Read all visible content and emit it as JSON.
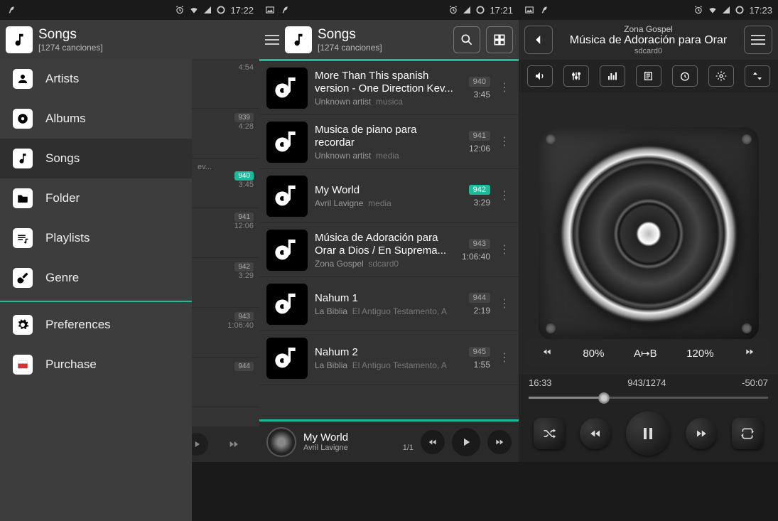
{
  "status": {
    "time1": "17:22",
    "time2": "17:21",
    "time3": "17:23"
  },
  "header": {
    "title": "Songs",
    "subtitle": "[1274 canciones]"
  },
  "drawer": {
    "items": [
      {
        "label": "Artists",
        "icon": "person-icon"
      },
      {
        "label": "Albums",
        "icon": "disc-icon"
      },
      {
        "label": "Songs",
        "icon": "music-note-icon"
      },
      {
        "label": "Folder",
        "icon": "folder-icon"
      },
      {
        "label": "Playlists",
        "icon": "playlist-icon"
      },
      {
        "label": "Genre",
        "icon": "guitar-icon"
      }
    ],
    "footer": [
      {
        "label": "Preferences",
        "icon": "gear-icon"
      },
      {
        "label": "Purchase",
        "icon": "cart-icon"
      }
    ]
  },
  "bg_peek": [
    {
      "badge": "",
      "dur": "4:54"
    },
    {
      "badge": "939",
      "dur": "4:28"
    },
    {
      "badge": "940",
      "dur": "3:45",
      "hl": true,
      "extra": "ev..."
    },
    {
      "badge": "941",
      "dur": "12:06"
    },
    {
      "badge": "942",
      "dur": "3:29"
    },
    {
      "badge": "943",
      "dur": "1:06:40"
    },
    {
      "badge": "944",
      "dur": ""
    }
  ],
  "songs": [
    {
      "title": "More Than This spanish version - One Direction Kev...",
      "artist": "Unknown artist",
      "source": "musica",
      "badge": "940",
      "dur": "3:45",
      "hl": false
    },
    {
      "title": "Musica de piano para recordar",
      "artist": "Unknown artist",
      "source": "media",
      "badge": "941",
      "dur": "12:06",
      "hl": false
    },
    {
      "title": "My World",
      "artist": "Avril Lavigne",
      "source": "media",
      "badge": "942",
      "dur": "3:29",
      "hl": true
    },
    {
      "title": "Música de Adoración para Orar a Dios / En Suprema...",
      "artist": "Zona Gospel",
      "source": "sdcard0",
      "badge": "943",
      "dur": "1:06:40",
      "hl": false
    },
    {
      "title": "Nahum 1",
      "artist": "La Biblia",
      "source": "El Antiguo Testamento, A",
      "badge": "944",
      "dur": "2:19",
      "hl": false
    },
    {
      "title": "Nahum 2",
      "artist": "La Biblia",
      "source": "El Antiguo Testamento, A",
      "badge": "945",
      "dur": "1:55",
      "hl": false
    }
  ],
  "now": {
    "title": "My World",
    "artist": "Avril Lavigne",
    "pos": "1/1"
  },
  "player": {
    "artist": "Zona Gospel",
    "title": "Música de Adoración para Orar",
    "source": "sdcard0",
    "ab_left": "80%",
    "ab_mid": "A↦B",
    "ab_right": "120%",
    "elapsed": "16:33",
    "counter": "943/1274",
    "remaining": "-50:07"
  }
}
